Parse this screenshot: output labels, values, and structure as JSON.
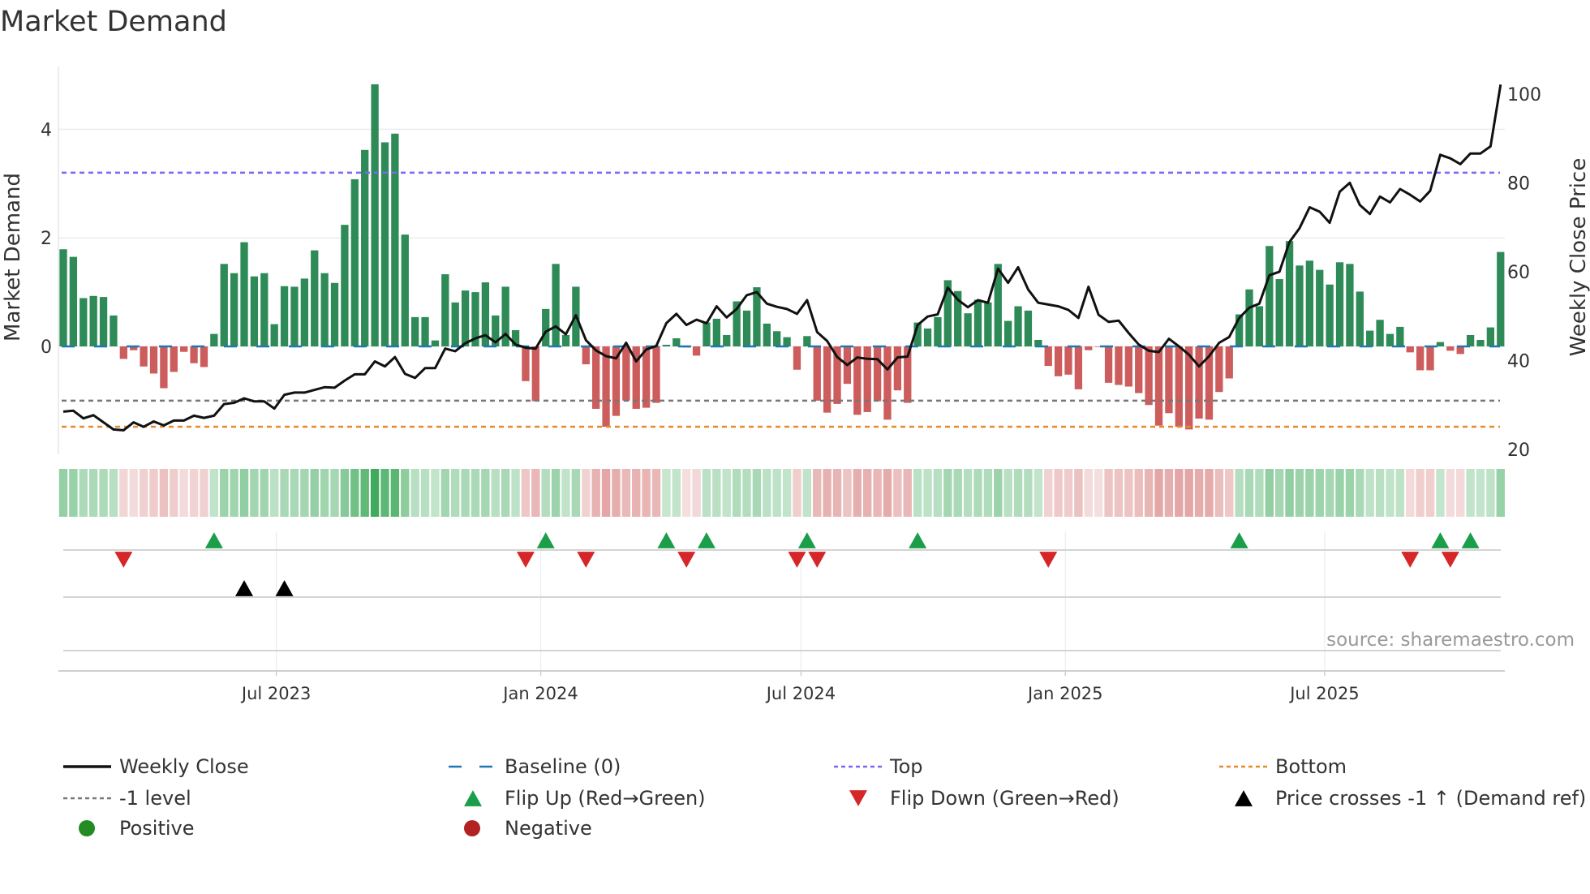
{
  "chart_data": {
    "type": "bar",
    "title": "Market Demand",
    "ylabel": "Market Demand",
    "y2label": "Weekly Close Price",
    "source": "source: sharemaestro.com",
    "ylim": [
      -2.0,
      5.17
    ],
    "y2lim": [
      17.3,
      105
    ],
    "y_ticks": [
      "0",
      "2",
      "4"
    ],
    "y_tick_values": [
      0,
      2,
      4
    ],
    "y2_ticks": [
      "20",
      "40",
      "60",
      "80",
      "100"
    ],
    "y2_tick_values": [
      20,
      40,
      60,
      80,
      100
    ],
    "x_ticks": [
      {
        "label": "Jul 2023",
        "week": 21.2
      },
      {
        "label": "Jan 2024",
        "week": 47.5
      },
      {
        "label": "Jul 2024",
        "week": 73.4
      },
      {
        "label": "Jan 2025",
        "week": 99.7
      },
      {
        "label": "Jul 2025",
        "week": 125.5
      }
    ],
    "levels": {
      "top": 3.2,
      "minus_one": -1.0,
      "bottom": -1.48,
      "baseline": 0
    },
    "demand": [
      1.79,
      1.65,
      0.89,
      0.93,
      0.91,
      0.57,
      -0.23,
      -0.07,
      -0.37,
      -0.5,
      -0.77,
      -0.47,
      -0.1,
      -0.31,
      -0.38,
      0.23,
      1.52,
      1.35,
      1.92,
      1.29,
      1.35,
      0.41,
      1.11,
      1.1,
      1.25,
      1.77,
      1.35,
      1.17,
      2.24,
      3.08,
      3.62,
      4.83,
      3.76,
      3.92,
      2.06,
      0.54,
      0.54,
      0.11,
      1.33,
      0.81,
      1.03,
      1.0,
      1.18,
      0.57,
      1.1,
      0.3,
      -0.64,
      -1.01,
      0.69,
      1.52,
      0.21,
      1.1,
      -0.33,
      -1.15,
      -1.48,
      -1.28,
      -1.0,
      -1.15,
      -1.13,
      -1.04,
      0.03,
      0.15,
      -0.02,
      -0.17,
      0.44,
      0.51,
      0.21,
      0.83,
      0.66,
      1.09,
      0.42,
      0.28,
      0.17,
      -0.43,
      0.19,
      -1.0,
      -1.22,
      -1.06,
      -0.69,
      -1.26,
      -1.21,
      -1.01,
      -1.35,
      -0.81,
      -1.04,
      0.44,
      0.33,
      0.54,
      1.22,
      1.02,
      0.61,
      0.86,
      0.81,
      1.52,
      0.47,
      0.74,
      0.66,
      0.12,
      -0.36,
      -0.55,
      -0.52,
      -0.79,
      -0.07,
      -0.01,
      -0.67,
      -0.71,
      -0.74,
      -0.86,
      -1.08,
      -1.46,
      -1.23,
      -1.48,
      -1.53,
      -1.33,
      -1.35,
      -0.84,
      -0.59,
      0.59,
      1.05,
      0.74,
      1.85,
      1.24,
      1.94,
      1.49,
      1.58,
      1.41,
      1.14,
      1.55,
      1.52,
      1.01,
      0.29,
      0.49,
      0.23,
      0.36,
      -0.11,
      -0.44,
      -0.44,
      0.08,
      -0.08,
      -0.14,
      0.21,
      0.12,
      0.35,
      1.74
    ],
    "weekly_close": [
      28.5,
      28.7,
      27.0,
      27.7,
      26.1,
      24.5,
      24.3,
      26.1,
      25.1,
      26.3,
      25.4,
      26.5,
      26.5,
      27.6,
      27.1,
      27.6,
      30.2,
      30.5,
      31.5,
      30.8,
      30.8,
      29.2,
      32.3,
      32.8,
      32.8,
      33.4,
      34.0,
      33.9,
      35.5,
      36.9,
      36.9,
      39.8,
      38.7,
      40.8,
      37.0,
      36.1,
      38.3,
      38.3,
      42.7,
      42.1,
      43.9,
      45.0,
      45.7,
      44.1,
      46.0,
      43.6,
      42.9,
      42.7,
      46.5,
      47.7,
      45.9,
      50.2,
      44.6,
      42.3,
      41.0,
      40.5,
      44.0,
      39.8,
      42.5,
      43.3,
      48.4,
      50.5,
      48.0,
      49.2,
      48.4,
      52.2,
      49.7,
      51.6,
      54.7,
      55.4,
      52.8,
      52.1,
      51.6,
      50.5,
      53.6,
      46.4,
      44.4,
      40.8,
      39.0,
      40.7,
      40.4,
      40.3,
      38.0,
      40.7,
      40.9,
      48.0,
      49.9,
      50.4,
      56.4,
      53.7,
      52.0,
      53.6,
      53.0,
      60.7,
      57.5,
      61.0,
      56.0,
      53.0,
      52.6,
      52.2,
      51.4,
      49.6,
      56.6,
      50.3,
      48.7,
      49.0,
      46.2,
      43.6,
      42.2,
      41.9,
      44.9,
      43.2,
      41.3,
      38.7,
      41.0,
      44.0,
      45.3,
      49.6,
      51.9,
      52.8,
      59.2,
      60.0,
      66.7,
      69.8,
      74.5,
      73.5,
      71.0,
      78.0,
      80.0,
      75.0,
      73.0,
      76.9,
      75.6,
      78.6,
      77.3,
      75.8,
      78.2,
      86.3,
      85.5,
      84.2,
      86.6,
      86.6,
      88.2,
      102.1
    ],
    "flip_up_weeks": [
      15,
      48,
      60,
      64,
      74,
      85,
      117,
      137,
      140
    ],
    "flip_down_weeks": [
      6,
      46,
      52,
      62,
      73,
      75,
      98,
      134,
      138
    ],
    "price_cross_weeks": [
      18,
      22
    ],
    "legend": [
      {
        "key": "weekly-close",
        "label": "Weekly Close"
      },
      {
        "key": "baseline",
        "label": "Baseline (0)"
      },
      {
        "key": "top",
        "label": "Top"
      },
      {
        "key": "bottom",
        "label": "Bottom"
      },
      {
        "key": "minus-one",
        "label": "-1 level"
      },
      {
        "key": "flip-up",
        "label": "Flip Up (Red→Green)"
      },
      {
        "key": "flip-down",
        "label": "Flip Down (Green→Red)"
      },
      {
        "key": "price-cross",
        "label": "Price crosses -1 ↑ (Demand ref)"
      },
      {
        "key": "positive",
        "label": "Positive"
      },
      {
        "key": "negative",
        "label": "Negative"
      }
    ],
    "legend_position": "bottom",
    "grid": true,
    "colors": {
      "positive_bar": "#2e8b57",
      "negative_bar": "#cd5c5c",
      "line": "#111111",
      "baseline": "#1f77b4",
      "top": "#7b68ee",
      "minus_one": "#777777",
      "bottom": "#e8892a",
      "flip_up": "#1a9e4a",
      "flip_down": "#d62728",
      "price_cross": "#000000",
      "positive_dot": "#228b22",
      "negative_dot": "#b22222"
    }
  }
}
